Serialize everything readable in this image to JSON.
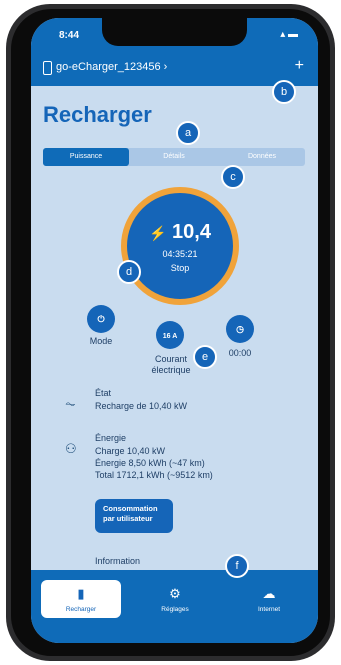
{
  "status": {
    "time": "8:44",
    "icons": "▴ ▬"
  },
  "device": {
    "name": "go-eCharger_123456",
    "chevron": "›",
    "add": "+"
  },
  "page": {
    "title": "Recharger"
  },
  "tabs": [
    {
      "label": "Puissance",
      "active": true
    },
    {
      "label": "Détails",
      "active": false
    },
    {
      "label": "Données",
      "active": false
    }
  ],
  "gauge": {
    "value": "10,4",
    "bolt": "⚡",
    "time": "04:35:21",
    "stop": "Stop",
    "ring_color": "#f0a33a"
  },
  "controls": [
    {
      "label": "Mode",
      "icon": "plug-icon",
      "glyph": "⏻"
    },
    {
      "label_line1": "Courant",
      "label_line2": "électrique",
      "badge": "16 A"
    },
    {
      "label": "00:00",
      "icon": "clock-icon",
      "glyph": "◷"
    }
  ],
  "state": {
    "title": "État",
    "value": "Recharge de 10,40 kW"
  },
  "energy": {
    "title": "Énergie",
    "lines": [
      "Charge 10,40 kW",
      "Énergie 8,50 kWh (~47 km)",
      "Total 1712,1 kWh (~9512 km)"
    ]
  },
  "consumption_button": {
    "line1": "Consommation",
    "line2": "par utilisateur"
  },
  "information": {
    "title": "Information"
  },
  "nav": [
    {
      "label": "Recharger",
      "active": true
    },
    {
      "label": "Réglages",
      "active": false
    },
    {
      "label": "Internet",
      "active": false
    }
  ],
  "markers": [
    "a",
    "b",
    "c",
    "d",
    "e",
    "f"
  ],
  "colors": {
    "primary": "#1565b8",
    "header": "#0f6bb8",
    "background": "#c9dcef",
    "accent": "#f0a33a"
  }
}
